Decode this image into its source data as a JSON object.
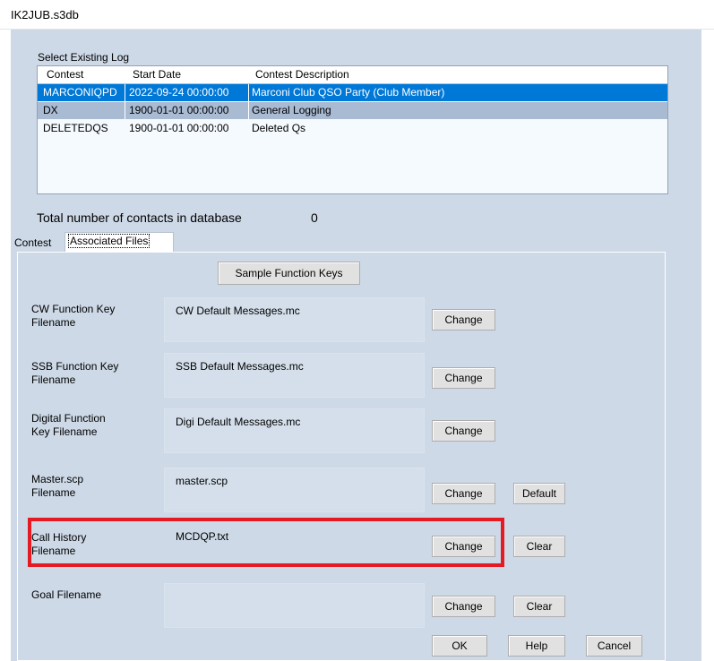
{
  "window": {
    "title": "IK2JUB.s3db"
  },
  "log_section": {
    "label": "Select Existing Log",
    "columns": [
      "Contest",
      "Start Date",
      "Contest Description"
    ],
    "rows": [
      {
        "contest": "MARCONIQPD",
        "start_date": "2022-09-24 00:00:00",
        "description": "Marconi Club QSO Party (Club Member)",
        "state": "selected"
      },
      {
        "contest": "DX",
        "start_date": "1900-01-01 00:00:00",
        "description": "General Logging",
        "state": "alternate"
      },
      {
        "contest": "DELETEDQS",
        "start_date": "1900-01-01 00:00:00",
        "description": "Deleted Qs",
        "state": "normal"
      }
    ]
  },
  "totals": {
    "label": "Total number of contacts in database",
    "value": "0"
  },
  "tabs": [
    {
      "label": "Contest",
      "active": false
    },
    {
      "label": "Associated Files",
      "active": true
    }
  ],
  "sample_button": "Sample Function Keys",
  "file_rows": [
    {
      "label_line1": "CW Function Key",
      "label_line2": "Filename",
      "filename": "CW Default Messages.mc",
      "buttons": [
        "Change"
      ]
    },
    {
      "label_line1": "SSB Function Key",
      "label_line2": "Filename",
      "filename": "SSB Default Messages.mc",
      "buttons": [
        "Change"
      ]
    },
    {
      "label_line1": "Digital Function",
      "label_line2": "Key Filename",
      "filename": "Digi Default Messages.mc",
      "buttons": [
        "Change"
      ]
    },
    {
      "label_line1": "Master.scp",
      "label_line2": "Filename",
      "filename": "master.scp",
      "buttons": [
        "Change",
        "Default"
      ]
    },
    {
      "label_line1": "Call History",
      "label_line2": "Filename",
      "filename": "MCDQP.txt",
      "buttons": [
        "Change",
        "Clear"
      ]
    },
    {
      "label_line1": "Goal Filename",
      "label_line2": "",
      "filename": "",
      "buttons": [
        "Change",
        "Clear"
      ]
    }
  ],
  "footer_buttons": {
    "ok": "OK",
    "help": "Help",
    "cancel": "Cancel"
  },
  "colors": {
    "dialog_bg": "#cdd9e7",
    "selection": "#0078d7",
    "alt_row": "#a9bad3",
    "highlight": "#e41b23"
  }
}
